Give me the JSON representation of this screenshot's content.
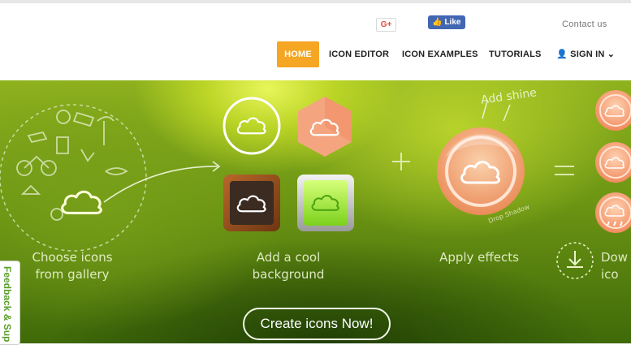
{
  "header": {
    "gplus_label": "G+",
    "fb_like_label": "Like 1",
    "contact_label": "Contact us"
  },
  "nav": {
    "home": "HOME",
    "icon_editor": "ICON EDITOR",
    "icon_examples": "ICON EXAMPLES",
    "tutorials": "TUTORIALS",
    "sign_in": "SIGN IN"
  },
  "hero": {
    "step1_line1": "Choose icons",
    "step1_line2": "from gallery",
    "step2_line1": "Add a cool",
    "step2_line2": "background",
    "step3": "Apply effects",
    "step4_line1": "Dow",
    "step4_line2": "ico",
    "add_shine": "Add shine",
    "drop_shadow": "Drop Shadow",
    "cta_label": "Create icons Now!"
  },
  "feedback_label": "Feedback & Sup",
  "colors": {
    "accent": "#f5a623",
    "facebook": "#4267b2",
    "feedback": "#5a9e28"
  }
}
